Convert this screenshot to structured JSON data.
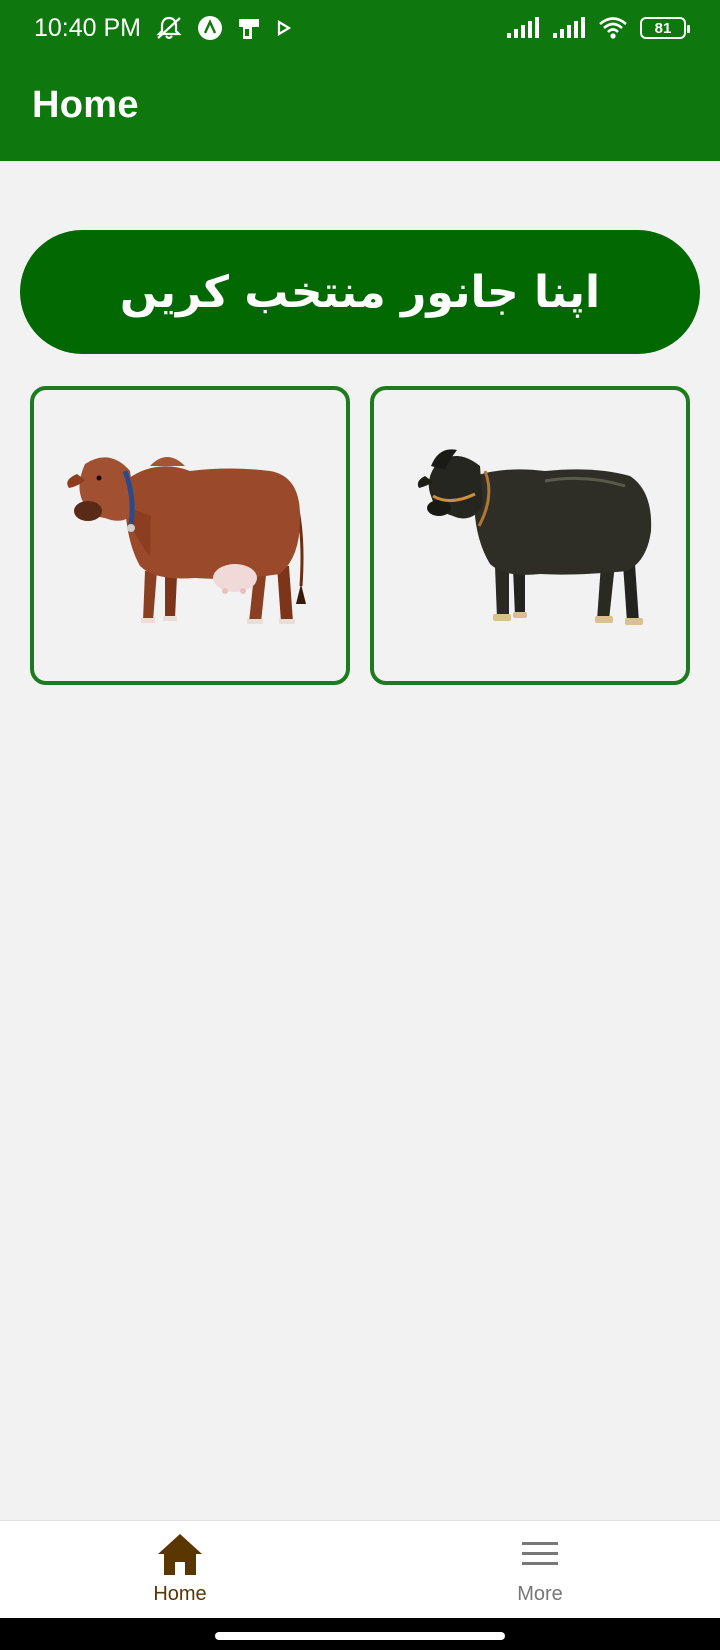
{
  "status_bar": {
    "time": "10:40 PM",
    "battery": "81",
    "icons": [
      "mute-icon",
      "location-a-icon",
      "sim-icon",
      "play-icon",
      "signal-icon",
      "signal-icon",
      "wifi-icon",
      "battery-icon"
    ]
  },
  "app_bar": {
    "title": "Home"
  },
  "main": {
    "select_animal_label": "اپنا جانور منتخب کریں",
    "animals": [
      {
        "name": "cow",
        "color": "#9a4a2a"
      },
      {
        "name": "buffalo",
        "color": "#2a2a22"
      }
    ]
  },
  "bottom_nav": {
    "items": [
      {
        "label": "Home",
        "icon": "home-icon",
        "active": true,
        "color": "#5a3600"
      },
      {
        "label": "More",
        "icon": "menu-icon",
        "active": false,
        "color": "#777777"
      }
    ]
  },
  "colors": {
    "primary": "#0e780e",
    "banner": "#026802",
    "card_border": "#1e7a1e",
    "background": "#f2f2f2"
  }
}
